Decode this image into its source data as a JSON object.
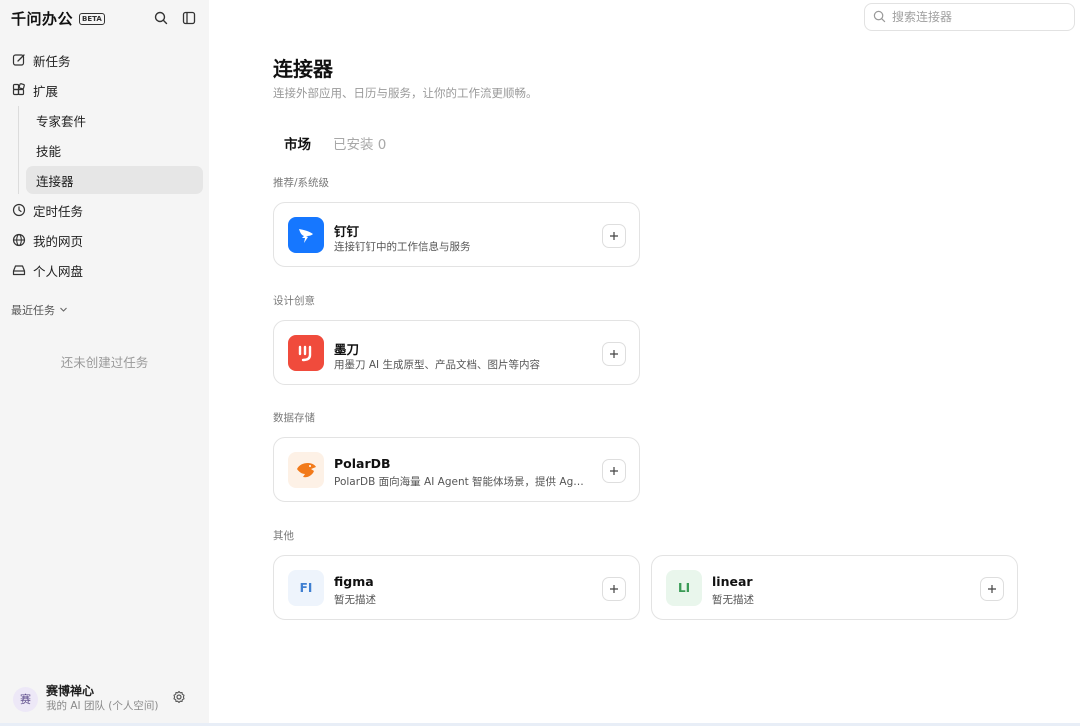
{
  "app": {
    "name": "千问办公",
    "badge": "BETA"
  },
  "sidebar": {
    "new_task": "新任务",
    "extensions": "扩展",
    "sub_items": [
      "专家套件",
      "技能",
      "连接器"
    ],
    "scheduled": "定时任务",
    "my_pages": "我的网页",
    "drive": "个人网盘",
    "recent_label": "最近任务",
    "empty_text": "还未创建过任务"
  },
  "user": {
    "avatar_char": "赛",
    "name": "赛博禅心",
    "team": "我的 AI 团队 (个人空间)"
  },
  "search": {
    "placeholder": "搜索连接器"
  },
  "page": {
    "title": "连接器",
    "subtitle": "连接外部应用、日历与服务，让你的工作流更顺畅。",
    "tabs": [
      "市场",
      "已安装 0"
    ]
  },
  "sections": [
    {
      "label": "推荐/系统级",
      "items": [
        {
          "name": "钉钉",
          "desc": "连接钉钉中的工作信息与服务"
        }
      ]
    },
    {
      "label": "设计创意",
      "items": [
        {
          "name": "墨刀",
          "desc": "用墨刀 AI 生成原型、产品文档、图片等内容"
        }
      ]
    },
    {
      "label": "数据存储",
      "items": [
        {
          "name": "PolarDB",
          "desc": "PolarDB 面向海量 AI Agent 智能体场景，提供 Agent 智能体数据库服务"
        }
      ]
    },
    {
      "label": "其他",
      "items": [
        {
          "name": "figma",
          "desc": "暂无描述",
          "initials": "FI"
        },
        {
          "name": "linear",
          "desc": "暂无描述",
          "initials": "LI"
        }
      ]
    }
  ],
  "colors": {
    "dingtalk": "#1677ff",
    "modao": "#f04b3c",
    "polardb": "#f27a1a",
    "figma_bg": "#eef4fc",
    "figma_text": "#3f7fd1",
    "linear_bg": "#e9f6ec",
    "linear_text": "#3a9b55"
  }
}
